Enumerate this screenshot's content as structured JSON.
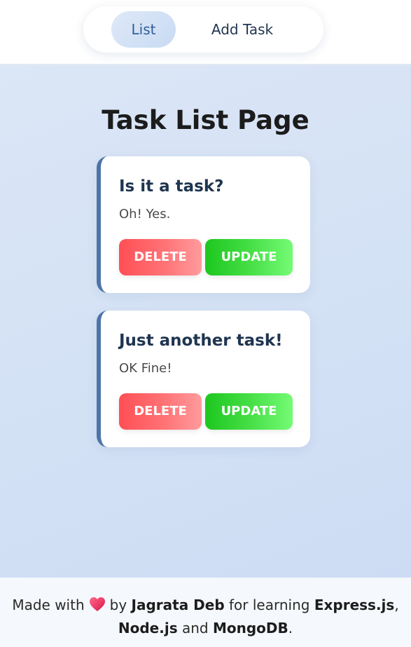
{
  "nav": {
    "items": [
      {
        "label": "List",
        "active": true
      },
      {
        "label": "Add Task",
        "active": false
      }
    ]
  },
  "main": {
    "title": "Task List Page",
    "tasks": [
      {
        "title": "Is it a task?",
        "description": "Oh! Yes.",
        "delete_label": "DELETE",
        "update_label": "UPDATE"
      },
      {
        "title": "Just another task!",
        "description": "OK Fine!",
        "delete_label": "DELETE",
        "update_label": "UPDATE"
      }
    ]
  },
  "footer": {
    "made_with": "Made with",
    "heart_icon": "heart-icon",
    "by": "by",
    "author": "Jagrata Deb",
    "for_learning": "for learning",
    "tech1": "Express.js",
    "comma": ",",
    "tech2": "Node.js",
    "and": "and",
    "tech3": "MongoDB",
    "period": "."
  },
  "colors": {
    "accent_border": "#4e74a6",
    "delete": "#ff4f55",
    "update": "#1dc71f",
    "nav_active_text": "#2f5e98"
  }
}
